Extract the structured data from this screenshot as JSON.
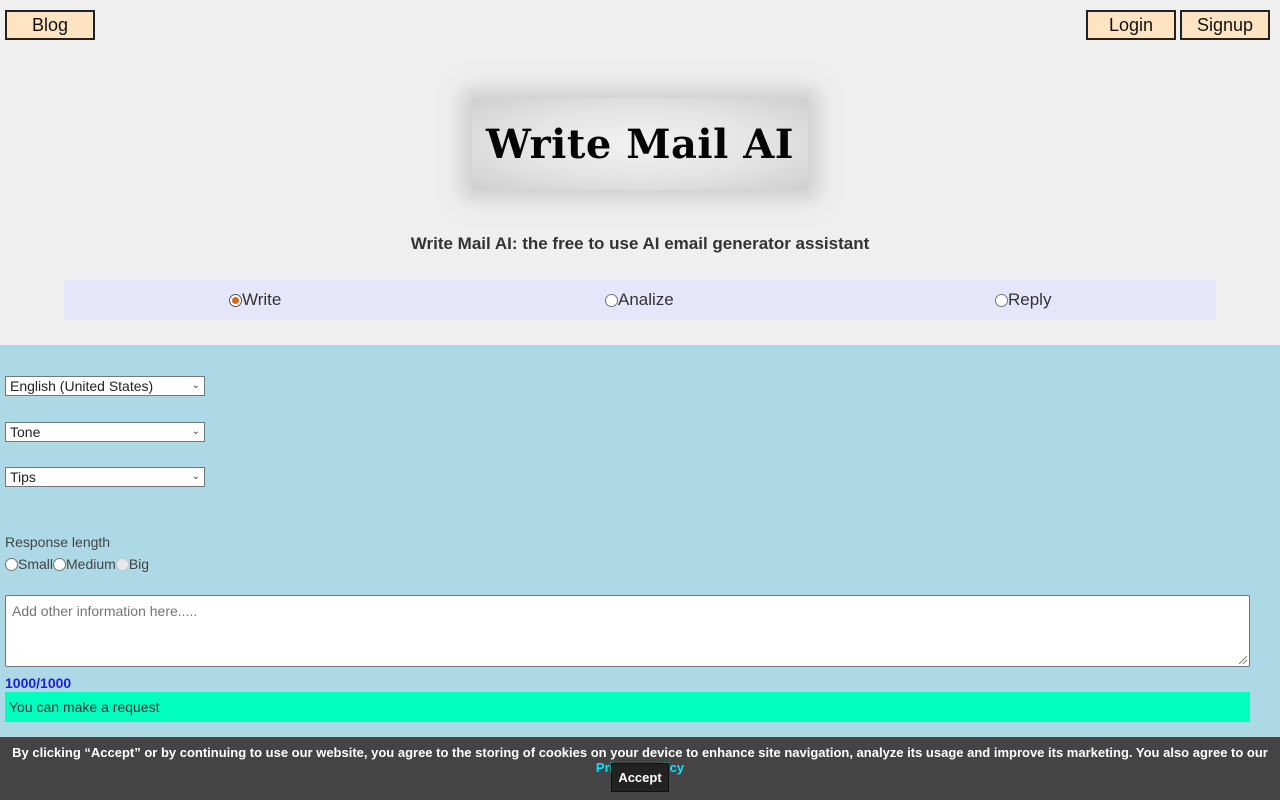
{
  "nav": {
    "blog_label": "Blog",
    "login_label": "Login",
    "signup_label": "Signup"
  },
  "header": {
    "logo_text": "Write Mail AI",
    "subtitle": "Write Mail AI: the free to use AI email generator assistant"
  },
  "modes": {
    "selected": "Write",
    "options": [
      {
        "label": "Write",
        "checked": true
      },
      {
        "label": "Analize",
        "checked": false
      },
      {
        "label": "Reply",
        "checked": false
      }
    ]
  },
  "form": {
    "language_select": "English (United States)",
    "tone_select": "Tone",
    "tips_select": "Tips",
    "response_length": {
      "label": "Response length",
      "options": [
        {
          "label": "Small",
          "checked": false,
          "disabled": false
        },
        {
          "label": "Medium",
          "checked": false,
          "disabled": false
        },
        {
          "label": "Big",
          "checked": false,
          "disabled": true
        }
      ]
    },
    "textarea_placeholder": "Add other information here.....",
    "char_counter": "1000/1000",
    "status_text": "You can make a request"
  },
  "cookie": {
    "text": "By clicking “Accept” or by continuing to use our website, you agree to the storing of cookies on your device to enhance site navigation, analyze its usage and improve its marketing. You also agree to our",
    "link_text": "Privacy Policy",
    "accept_label": "Accept"
  },
  "colors": {
    "page_bg": "#efefef",
    "nav_button_bg": "#ffe4c4",
    "mode_bar_bg": "#e6e6fa",
    "form_bg": "#add8e6",
    "status_bg": "#00ffbf",
    "counter_color": "#1f1fd4",
    "cookie_bg": "#444444",
    "cookie_link": "#00e5ff",
    "radio_checked": "#d2691e"
  }
}
